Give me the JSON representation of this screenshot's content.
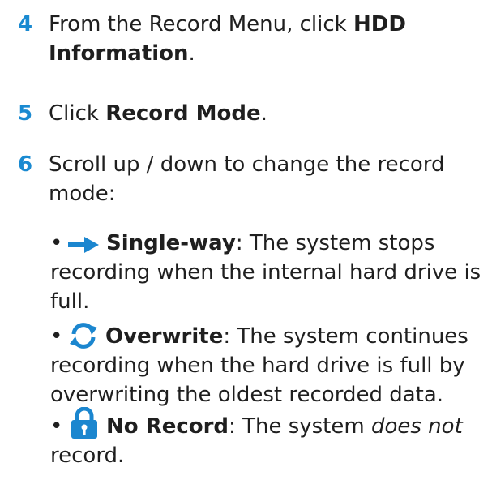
{
  "steps": [
    {
      "number": "4",
      "text_before": "From the Record Menu, click ",
      "bold_line1": "HDD",
      "bold_line2": "Information",
      "text_after": "."
    },
    {
      "number": "5",
      "text_before": "Click ",
      "bold": "Record Mode",
      "text_after": "."
    },
    {
      "number": "6",
      "line1": "Scroll up / down to change the record",
      "line2": "mode:"
    }
  ],
  "modes": [
    {
      "icon": "arrow-right-icon",
      "name": "Single-way",
      "colon": ":",
      "desc_first": " The system stops",
      "desc_rest_1": "recording when the internal hard drive is",
      "desc_rest_2": "full."
    },
    {
      "icon": "overwrite-cycle-icon",
      "name": "Overwrite",
      "colon": ":",
      "desc_first": " The system continues",
      "desc_rest_1": "recording when the hard drive is full by",
      "desc_rest_2": "overwriting the oldest recorded data."
    },
    {
      "icon": "lock-icon",
      "name": "No Record",
      "colon": ":",
      "desc_first": " The system ",
      "desc_italic": "does not",
      "desc_rest_1": "record."
    }
  ],
  "colors": {
    "step_number": "#1a8ad1",
    "icon_blue": "#1b86cf",
    "text": "#1f1f1f"
  }
}
